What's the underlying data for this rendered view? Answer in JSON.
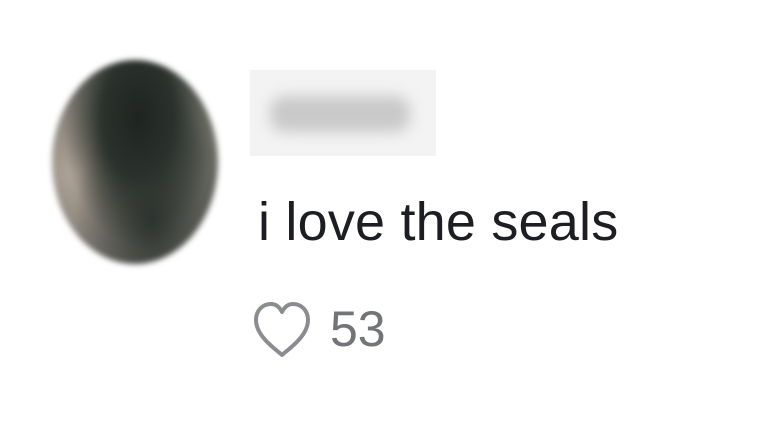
{
  "comment": {
    "username": "",
    "text": "i love the seals",
    "like_count": "53",
    "icons": {
      "like": "heart-outline-icon"
    },
    "colors": {
      "text": "#1c1e22",
      "muted": "#727477"
    }
  }
}
